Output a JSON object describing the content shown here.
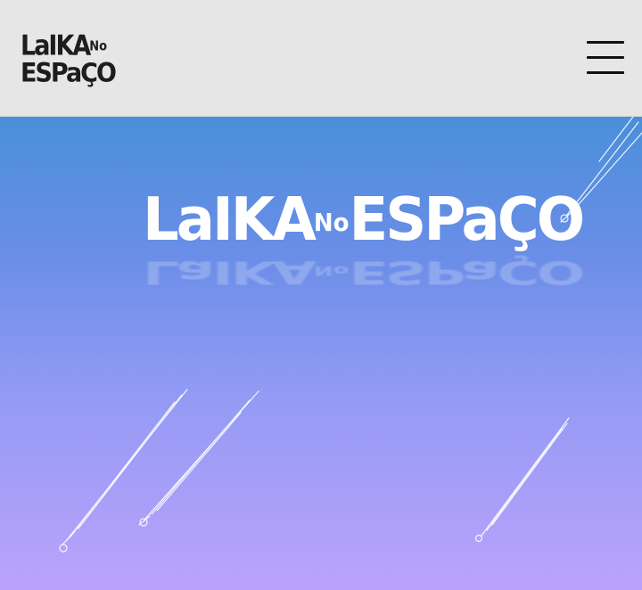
{
  "header": {
    "logo_line1": "LaIKA",
    "logo_no": "No",
    "logo_line2": "ESPaÇO"
  },
  "hero": {
    "title": "LaIKA",
    "title_no": "No",
    "title_end": "ESPaÇO"
  },
  "icons": {
    "menu": "hamburger-menu-icon",
    "comets": "shooting-star-icon"
  },
  "colors": {
    "header_bg": "#e6e6e6",
    "hero_top": "#4a8fd9",
    "hero_bottom": "#bba2fb",
    "title": "#ffffff"
  }
}
